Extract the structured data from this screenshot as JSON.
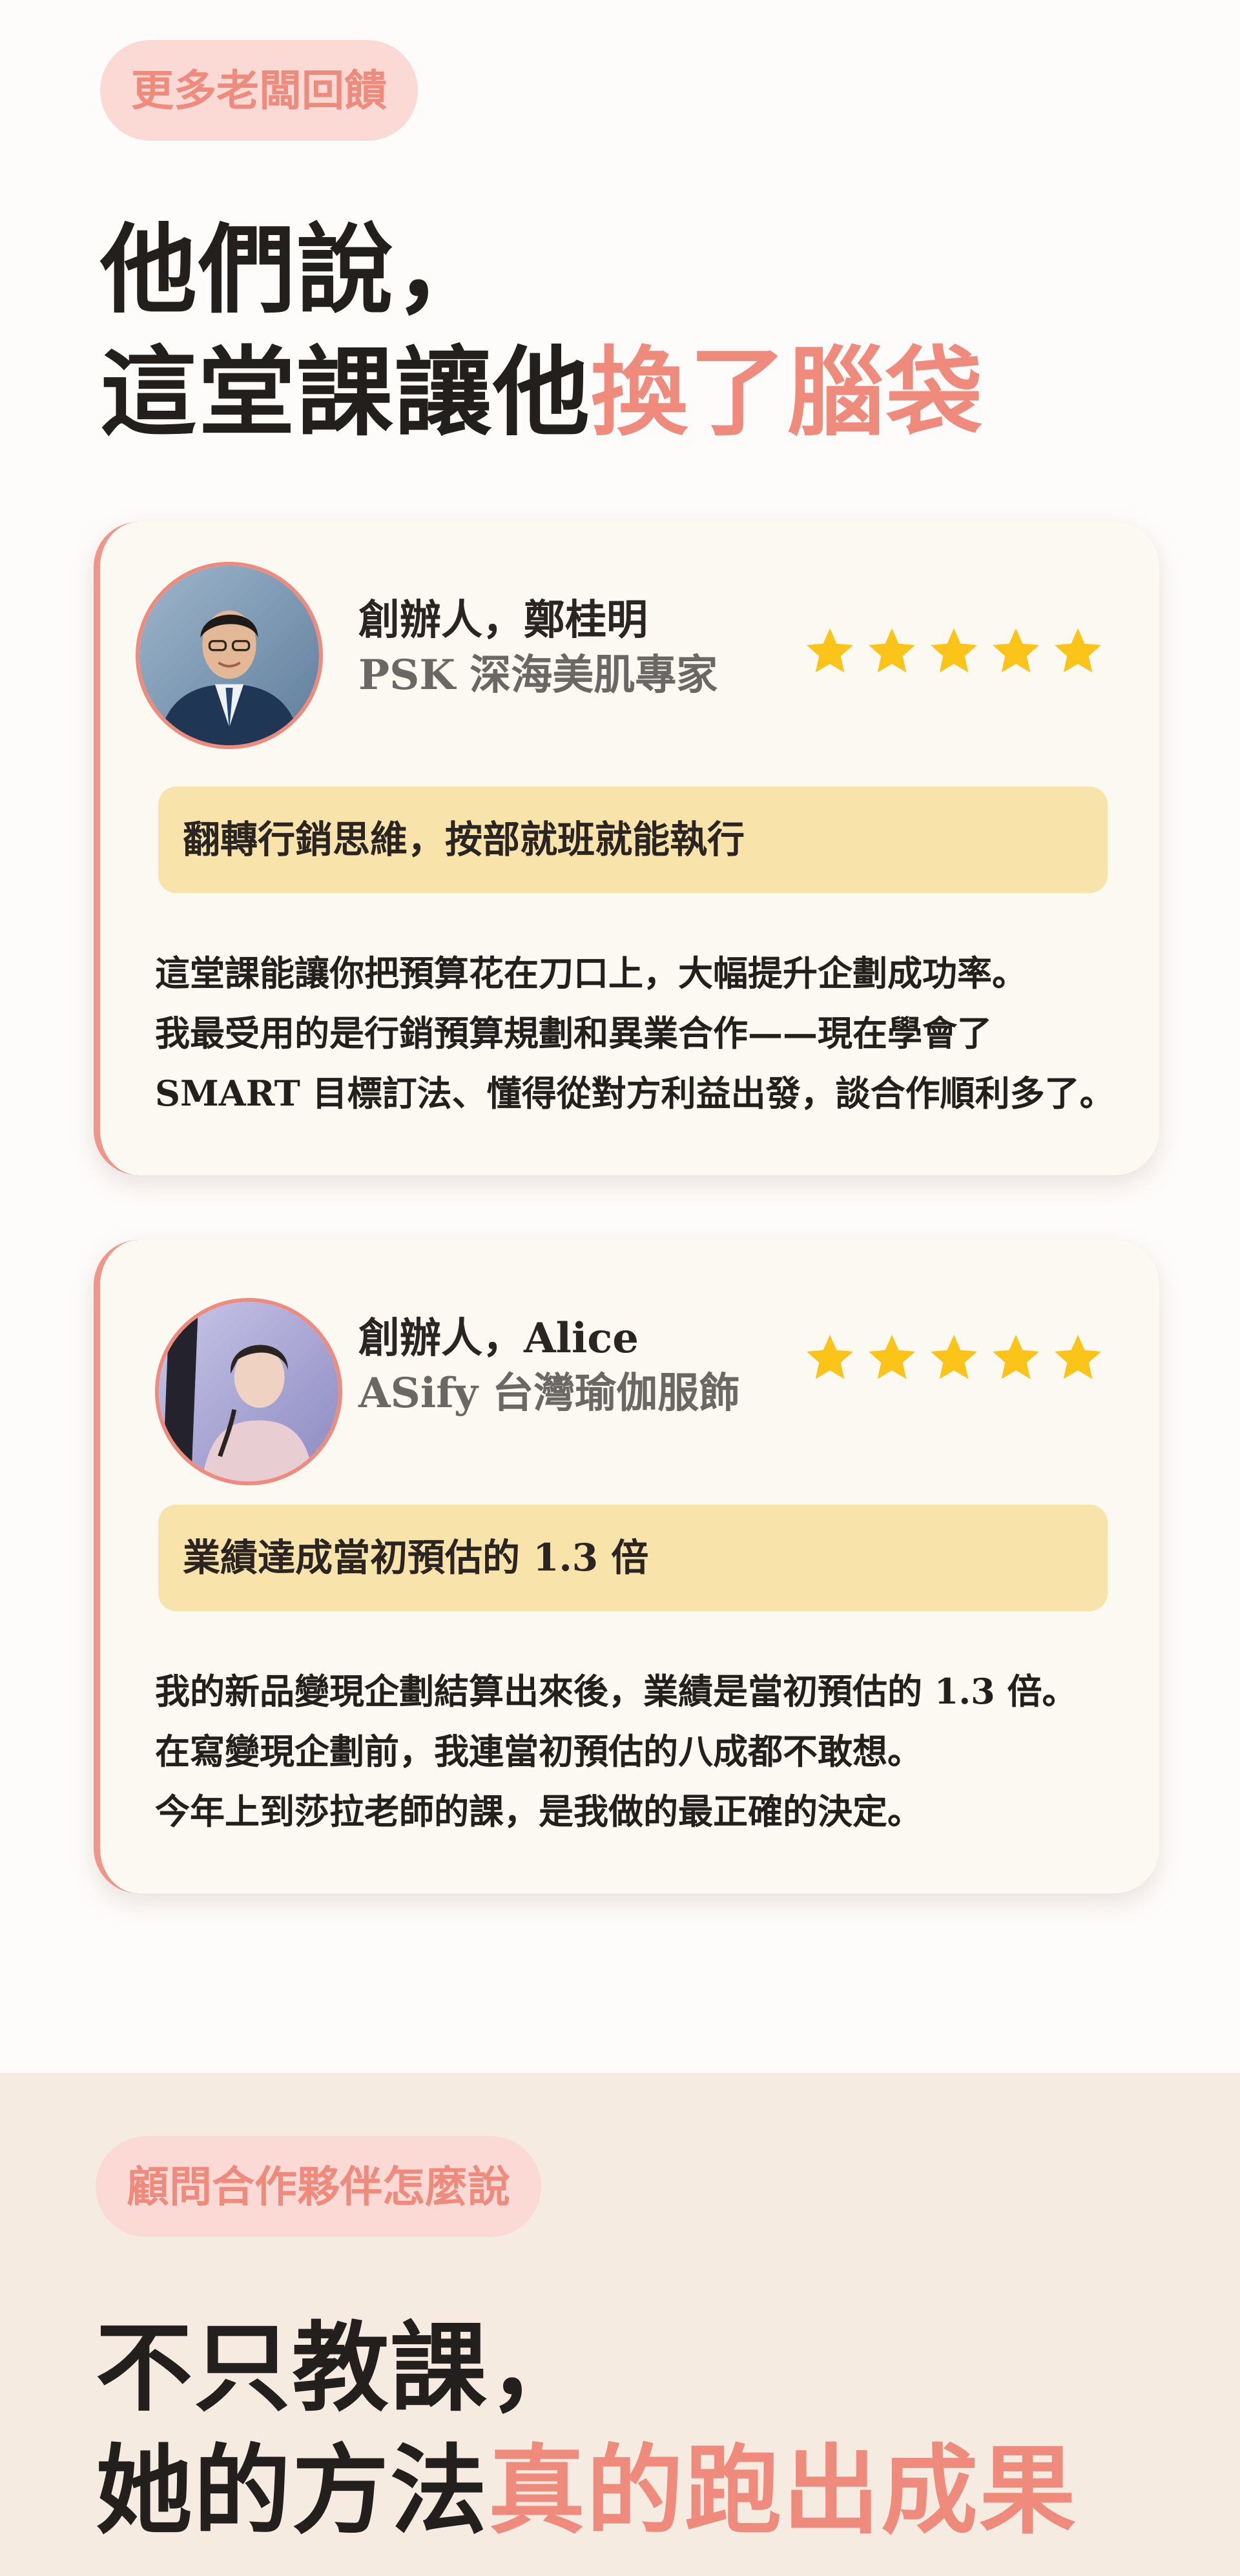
{
  "section1": {
    "tag": "更多老闆回饋",
    "headline_line1": "他們說，",
    "headline_line2_plain": "這堂課讓他",
    "headline_line2_accent": "換了腦袋"
  },
  "testimonials": [
    {
      "name": "創辦人，鄭桂明",
      "company": "PSK 深海美肌專家",
      "rating": 5,
      "highlight": "翻轉行銷思維，按部就班就能執行",
      "quote_lines": [
        "這堂課能讓你把預算花在刀口上，大幅提升企劃成功率。",
        "我最受用的是行銷預算規劃和異業合作——現在學會了",
        "SMART 目標訂法、懂得從對方利益出發，談合作順利多了。"
      ]
    },
    {
      "name": "創辦人，Alice",
      "company": "ASify 台灣瑜伽服飾",
      "rating": 5,
      "highlight": "業績達成當初預估的 1.3 倍",
      "quote_lines": [
        "我的新品變現企劃結算出來後，業績是當初預估的 1.3 倍。",
        "在寫變現企劃前，我連當初預估的八成都不敢想。",
        "今年上到莎拉老師的課，是我做的最正確的決定。"
      ]
    }
  ],
  "section2": {
    "tag": "顧問合作夥伴怎麼說",
    "headline_line1": "不只教課，",
    "headline_line2_plain": "她的方法",
    "headline_line2_accent": "真的跑出成果"
  },
  "colors": {
    "accent": "#ee8b7d",
    "tag_bg": "#fbd9d4",
    "card_bg": "#fcf8f2",
    "highlight_bg": "#f8e3aa",
    "star": "#fcc419",
    "section2_bg": "#f6ebe1"
  },
  "icons": {
    "star": "star-icon",
    "avatar1": "portrait-man-suit",
    "avatar2": "portrait-woman-yoga"
  }
}
